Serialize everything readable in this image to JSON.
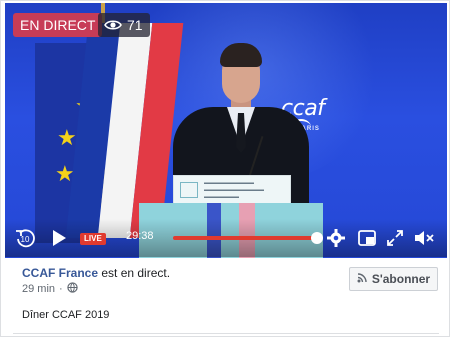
{
  "video": {
    "live_badge": "EN DIRECT",
    "viewer_count": "71",
    "backdrop_logo": "ccaf",
    "backdrop_city": "PARIS",
    "controls": {
      "live_label": "LIVE",
      "time": "29:38",
      "progress_fraction": 0.99
    }
  },
  "post": {
    "page_name": "CCAF France",
    "status_text": " est en direct.",
    "time_ago": "29 min",
    "separator": "·",
    "subscribe_label": "S'abonner",
    "caption": "Dîner CCAF 2019"
  },
  "icons": [
    "eye-icon",
    "rewind-10-icon",
    "play-icon",
    "settings-gear-icon",
    "picture-in-picture-icon",
    "fullscreen-icon",
    "volume-muted-icon",
    "globe-icon",
    "rss-icon"
  ],
  "colors": {
    "live_badge": "#c73c57",
    "progress": "#e03a2f",
    "link": "#385898"
  }
}
